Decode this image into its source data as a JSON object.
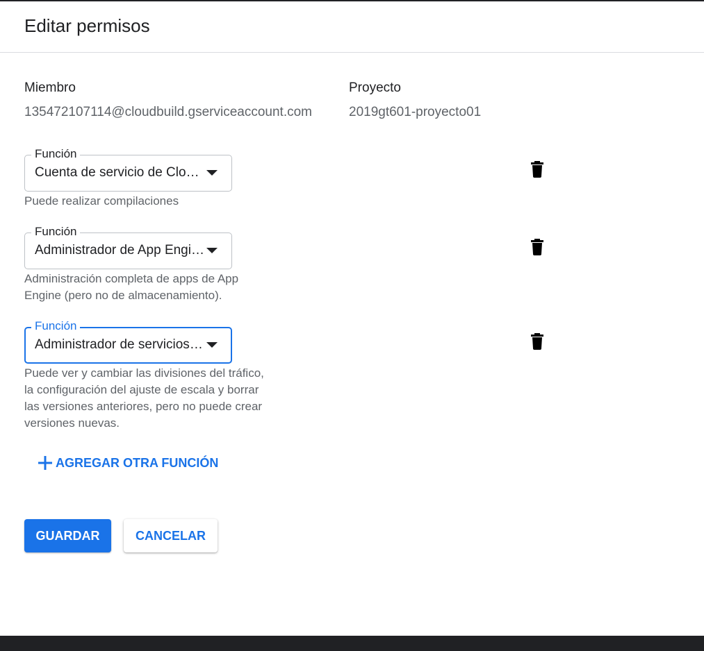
{
  "dialog": {
    "title": "Editar permisos"
  },
  "member": {
    "label": "Miembro",
    "value": "135472107114@cloudbuild.gserviceaccount.com"
  },
  "project": {
    "label": "Proyecto",
    "value": "2019gt601-proyecto01"
  },
  "roles": [
    {
      "label": "Función",
      "value": "Cuenta de servicio de Cloud Build",
      "description": "Puede realizar compilaciones",
      "delete_icon": "trash-icon"
    },
    {
      "label": "Función",
      "value": "Administrador de App Engine",
      "description": "Administración completa de apps de App Engine (pero no de almacenamiento).",
      "delete_icon": "trash-icon"
    },
    {
      "label": "Función",
      "value": "Administrador de servicios de App Engine",
      "description": "Puede ver y cambiar las divisiones del tráfico, la configuración del ajuste de escala y borrar las versiones anteriores, pero no puede crear versiones nuevas.",
      "delete_icon": "trash-icon",
      "focused": true
    }
  ],
  "actions": {
    "add_role": "AGREGAR OTRA FUNCIÓN",
    "add_icon": "plus-icon",
    "save": "GUARDAR",
    "cancel": "CANCELAR"
  },
  "colors": {
    "accent": "#1a73e8",
    "text": "#202124",
    "secondary_text": "#5f6368",
    "border": "#bdc1c6"
  }
}
